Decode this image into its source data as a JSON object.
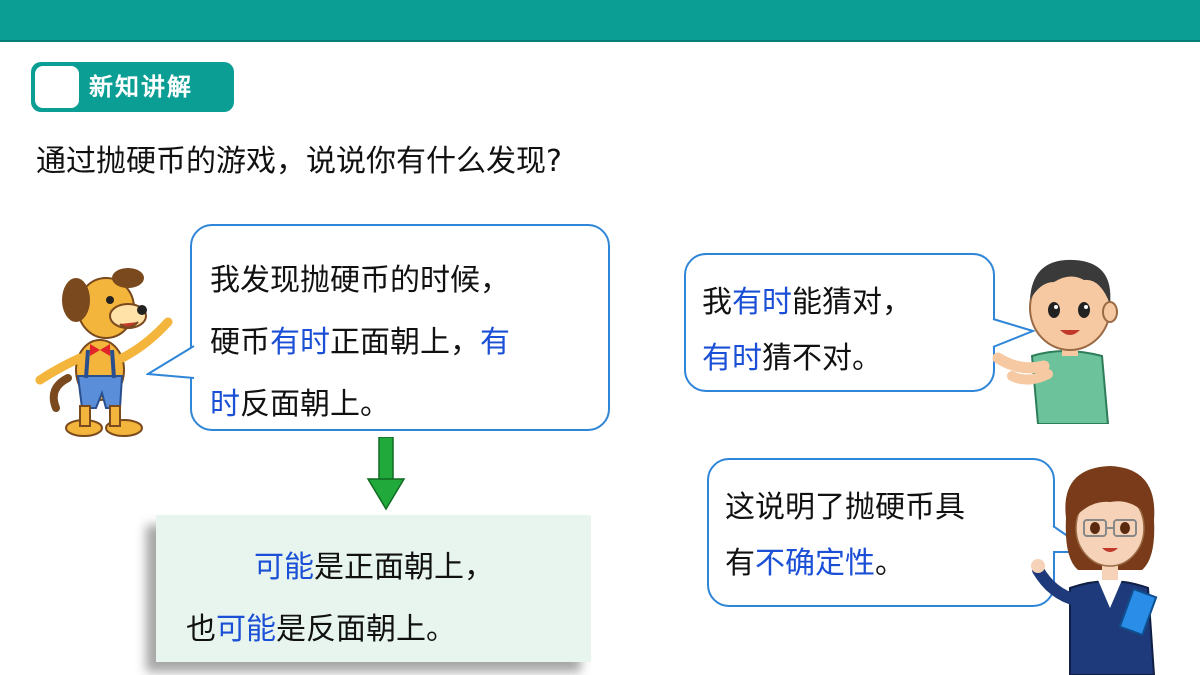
{
  "header": {
    "section_label": "新知讲解"
  },
  "question": "通过抛硬币的游戏，说说你有什么发现?",
  "dog_bubble": {
    "l1": "我发现抛硬币的时候，",
    "l2a": "硬币",
    "l2b": "有时",
    "l2c": "正面朝上，",
    "l2d": "有",
    "l3a": "时",
    "l3b": "反面朝上。"
  },
  "boy_bubble": {
    "l1a": "我",
    "l1b": "有时",
    "l1c": "能猜对，",
    "l2a": "有时",
    "l2b": "猜不对。"
  },
  "girl_bubble": {
    "l1": "这说明了抛硬币具",
    "l2a": "有",
    "l2b": "不确定性",
    "l2c": "。"
  },
  "conclusion": {
    "l1a": "可能",
    "l1b": "是正面朝上，",
    "l2a": "也",
    "l2b": "可能",
    "l2c": "是反面朝上。"
  },
  "colors": {
    "accent": "#0a9e95",
    "bubble_border": "#2f86d8",
    "highlight": "#1a4fd6",
    "arrow": "#22a93c",
    "conclusion_bg": "#e8f5ee"
  },
  "characters": [
    "dog-cartoon",
    "boy-cartoon",
    "teacher-cartoon"
  ]
}
